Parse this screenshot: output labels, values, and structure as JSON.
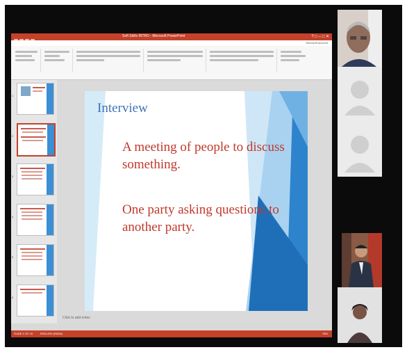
{
  "app": {
    "window_title": "Soft Skills INTRO - Microsoft PowerPoint",
    "account": "Microsoft account"
  },
  "menu": {
    "tabs": [
      "FILE",
      "HOME",
      "INSERT",
      "DESIGN",
      "TRANSITIONS",
      "ANIMATIONS",
      "SLIDE SHOW",
      "REVIEW",
      "VIEW"
    ]
  },
  "slide": {
    "title": "Interview",
    "point1": "A meeting of people to discuss something.",
    "point2": "One party asking questions to another party."
  },
  "thumbnails": [
    "1",
    "2",
    "3",
    "4",
    "5",
    "6"
  ],
  "notes_placeholder": "Click to add notes",
  "status": {
    "slide_count": "SLIDE 2 OF 16",
    "language": "ENGLISH (INDIA)",
    "zoom": "78%"
  },
  "participants": [
    "participant-1",
    "participant-2",
    "participant-3",
    "participant-4",
    "participant-5"
  ],
  "colors": {
    "accent": "#c4412a",
    "slide_title": "#3b75b7",
    "slide_body": "#c0392b",
    "slide_shapes": "#2e84cc"
  }
}
